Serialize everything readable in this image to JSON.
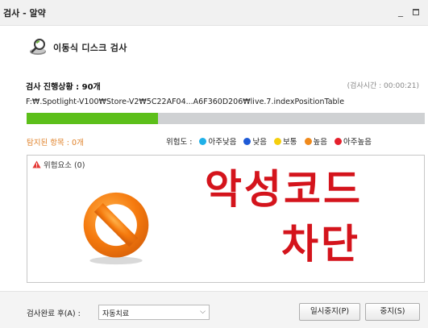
{
  "window": {
    "title": "검사 - 알약",
    "minimize_glyph": "_"
  },
  "header": {
    "title": "이동식 디스크 검사",
    "icon": "magnifier-disk-icon"
  },
  "scan": {
    "status_label": "검사 진행상황 : 90개",
    "elapsed_label": "(검사시간 : 00:00:21)",
    "current_path": "F:₩.Spotlight-V100₩Store-V2₩5C22AF04...A6F360D206₩live.7.indexPositionTable",
    "progress_fraction": 0.33
  },
  "results": {
    "detected_label": "탐지된 항목 : 0개",
    "risk_legend_label": "위험도 :",
    "risk_levels": [
      {
        "label": "아주낮음",
        "color": "#1fb0e8"
      },
      {
        "label": "낮음",
        "color": "#1e5ad6"
      },
      {
        "label": "보통",
        "color": "#f5cf0d"
      },
      {
        "label": "높음",
        "color": "#f08a1c"
      },
      {
        "label": "아주높음",
        "color": "#e5202c"
      }
    ],
    "risk_group_label": "위험요소 (0)",
    "overlay_line1": "악성코드",
    "overlay_line2": "차단"
  },
  "footer": {
    "after_scan_label": "검사완료 후(A) :",
    "after_scan_value": "자동치료",
    "pause_label": "일시중지(P)",
    "stop_label": "중지(S)"
  },
  "colors": {
    "progress_fill": "#5cbf1a",
    "progress_track": "#cfd1d3",
    "alert_red": "#d4141c",
    "detected_orange": "#e0822a"
  }
}
